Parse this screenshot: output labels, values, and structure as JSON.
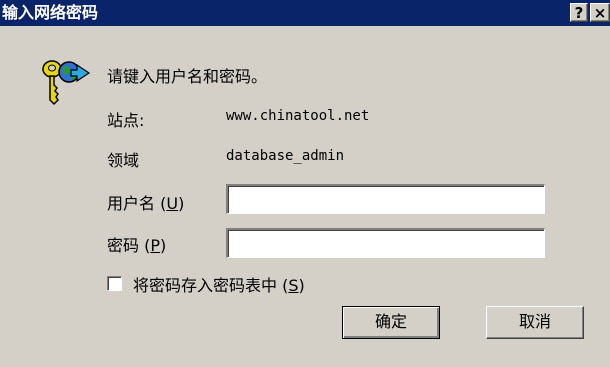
{
  "window": {
    "title": "输入网络密码",
    "help_label": "?",
    "close_label": "×"
  },
  "dialog": {
    "prompt": "请键入用户名和密码。",
    "site_label": "站点:",
    "site_value": "www.chinatool.net",
    "realm_label": "领域",
    "realm_value": "database_admin",
    "username_label": "用户名",
    "username_mnemonic": "(U)",
    "username_value": "",
    "password_label": "密码",
    "password_mnemonic": "(P)",
    "password_value": "",
    "save_password_label": "将密码存入密码表中",
    "save_password_mnemonic": "(S)",
    "save_password_checked": false,
    "ok_label": "确定",
    "cancel_label": "取消"
  },
  "colors": {
    "titlebar": "#0a246a",
    "dialog_bg": "#d4d0c8"
  },
  "icons": [
    "keys-globe-icon"
  ]
}
